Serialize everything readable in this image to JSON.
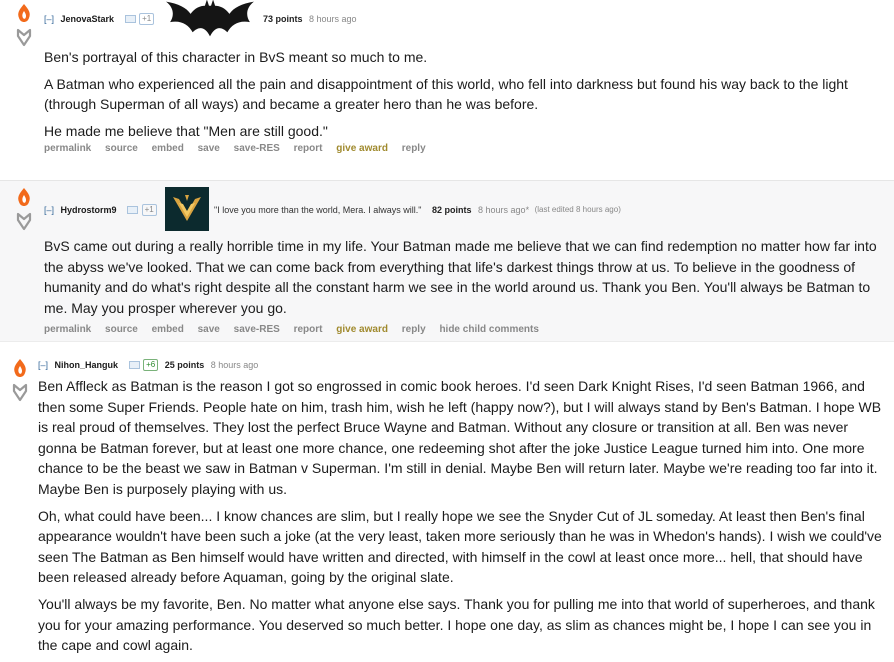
{
  "comments": [
    {
      "expand": "[–]",
      "author": "JenovaStark",
      "flair_count": "+1",
      "score": "73 points",
      "time": "8 hours ago",
      "paragraphs": [
        "Ben's portrayal of this character in BvS meant so much to me.",
        "A Batman who experienced all the pain and disappointment of this world, who fell into darkness but found his way back to the light (through Superman of all ways) and became a greater hero than he was before.",
        "He made me believe that \"Men are still good.\""
      ],
      "buttons": [
        "permalink",
        "source",
        "embed",
        "save",
        "save-RES",
        "report",
        "give award",
        "reply"
      ]
    },
    {
      "expand": "[–]",
      "author": "Hydrostorm9",
      "flair_count": "+1",
      "flair_text": "\"I love you more than the world, Mera. I always will.\"",
      "score": "82 points",
      "time": "8 hours ago*",
      "edited": "(last edited 8 hours ago)",
      "paragraphs": [
        "BvS came out during a really horrible time in my life. Your Batman made me believe that we can find redemption no matter how far into the abyss we've looked. That we can come back from everything that life's darkest things throw at us. To believe in the goodness of humanity and do what's right despite all the constant harm we see in the world around us. Thank you Ben. You'll always be Batman to me. May you prosper wherever you go."
      ],
      "buttons": [
        "permalink",
        "source",
        "embed",
        "save",
        "save-RES",
        "report",
        "give award",
        "reply",
        "hide child comments"
      ]
    },
    {
      "expand": "[–]",
      "author": "Nihon_Hanguk",
      "flair_count": "+6",
      "score": "25 points",
      "time": "8 hours ago",
      "paragraphs": [
        "Ben Affleck as Batman is the reason I got so engrossed in comic book heroes. I'd seen Dark Knight Rises, I'd seen Batman 1966, and then some Super Friends. People hate on him, trash him, wish he left (happy now?), but I will always stand by Ben's Batman. I hope WB is real proud of themselves. They lost the perfect Bruce Wayne and Batman. Without any closure or transition at all. Ben was never gonna be Batman forever, but at least one more chance, one redeeming shot after the joke Justice League turned him into. One more chance to be the beast we saw in Batman v Superman. I'm still in denial. Maybe Ben will return later. Maybe we're reading too far into it. Maybe Ben is purposely playing with us.",
        "Oh, what could have been... I know chances are slim, but I really hope we see the Snyder Cut of JL someday. At least then Ben's final appearance wouldn't have been such a joke (at the very least, taken more seriously than he was in Whedon's hands). I wish we could've seen The Batman as Ben himself would have written and directed, with himself in the cowl at least once more... hell, that should have been released already before Aquaman, going by the original slate.",
        "You'll always be my favorite, Ben. No matter what anyone else says. Thank you for pulling me into that world of superheroes, and thank you for your amazing performance. You deserved so much better. I hope one day, as slim as chances might be, I hope I can see you in the cape and cowl again."
      ]
    }
  ]
}
